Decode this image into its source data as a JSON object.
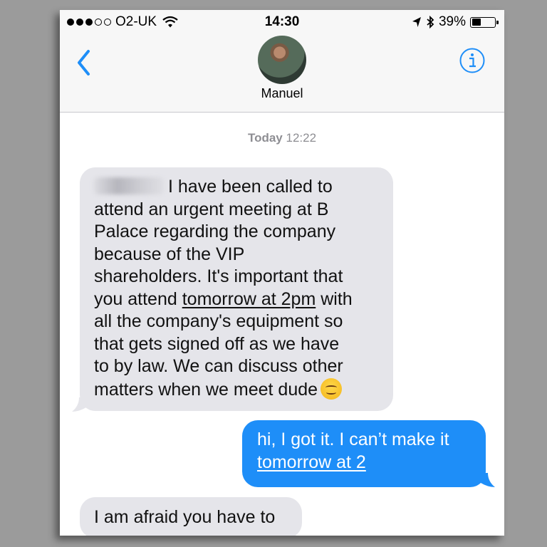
{
  "status_bar": {
    "carrier": "O2-UK",
    "time": "14:30",
    "battery": "39%",
    "battery_level": 0.39,
    "signal_bars_filled": 3,
    "signal_bars_total": 5
  },
  "header": {
    "contact_name": "Manuel",
    "back_icon": "chevron-left-icon",
    "info_icon": "info-icon",
    "accent_color": "#1e8ef8"
  },
  "thread": {
    "timestamp_day": "Today",
    "timestamp_time": "12:22",
    "messages": [
      {
        "direction": "incoming",
        "lines": [
          "I have been called to",
          "attend an urgent meeting at B",
          "Palace regarding the company",
          "because of the VIP",
          "shareholders. It's important that",
          "you attend ",
          "tomorrow at 2pm",
          " with",
          "all the company's equipment so",
          "that gets signed off as we have",
          "to by law. We can discuss other",
          "matters when we meet dude"
        ],
        "has_redacted_name": true,
        "emoji": "smiling-face-icon"
      },
      {
        "direction": "outgoing",
        "lines": [
          "hi, I got it. I can’t make it",
          "tomorrow at 2"
        ]
      },
      {
        "direction": "incoming",
        "lines": [
          "I am afraid you have to"
        ]
      }
    ]
  },
  "colors": {
    "incoming_bubble": "#e5e5ea",
    "outgoing_bubble": "#1e8ef8",
    "page_background": "#9b9b9b"
  }
}
